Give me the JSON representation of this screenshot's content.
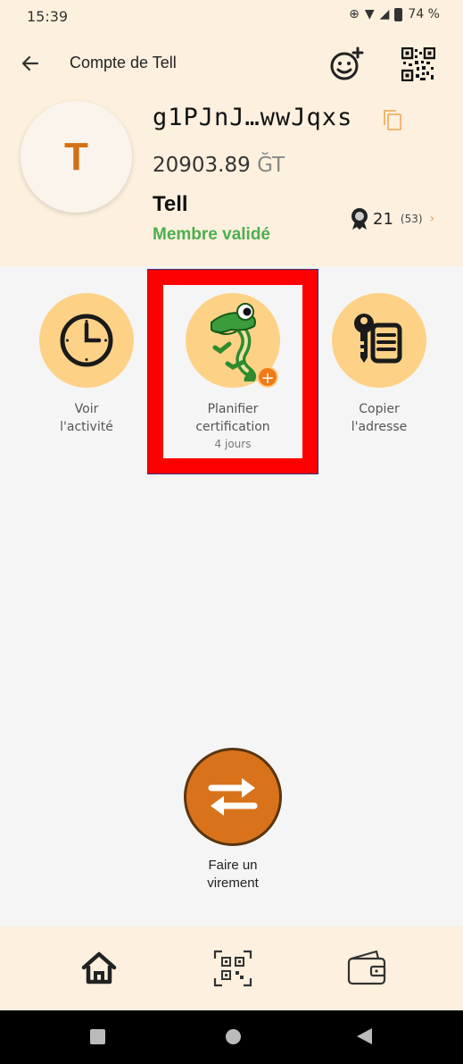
{
  "status_bar": {
    "time": "15:39",
    "battery": "74 %"
  },
  "app_bar": {
    "title": "Compte de Tell"
  },
  "profile": {
    "avatar_letter": "T",
    "address": "g1PJnJ…wwJqxs",
    "balance": "20903.89",
    "currency": "ĞT",
    "name": "Tell",
    "status": "Membre validé",
    "certifications_received": "21",
    "certifications_total": "(53)"
  },
  "actions": {
    "activity": {
      "label_line1": "Voir",
      "label_line2": "l'activité"
    },
    "certify": {
      "label_line1": "Planifier",
      "label_line2": "certification",
      "sublabel": "4 jours"
    },
    "copy_address": {
      "label_line1": "Copier",
      "label_line2": "l'adresse"
    }
  },
  "transfer": {
    "label_line1": "Faire un",
    "label_line2": "virement"
  },
  "bottom_nav": {
    "items": [
      "home-icon",
      "qr-scan-icon",
      "wallet-icon"
    ]
  },
  "colors": {
    "header_bg": "#fdf0de",
    "accent": "#d9731b",
    "action_circle": "#fdd287",
    "valid_green": "#4caf50",
    "highlight": "#ff0000"
  }
}
